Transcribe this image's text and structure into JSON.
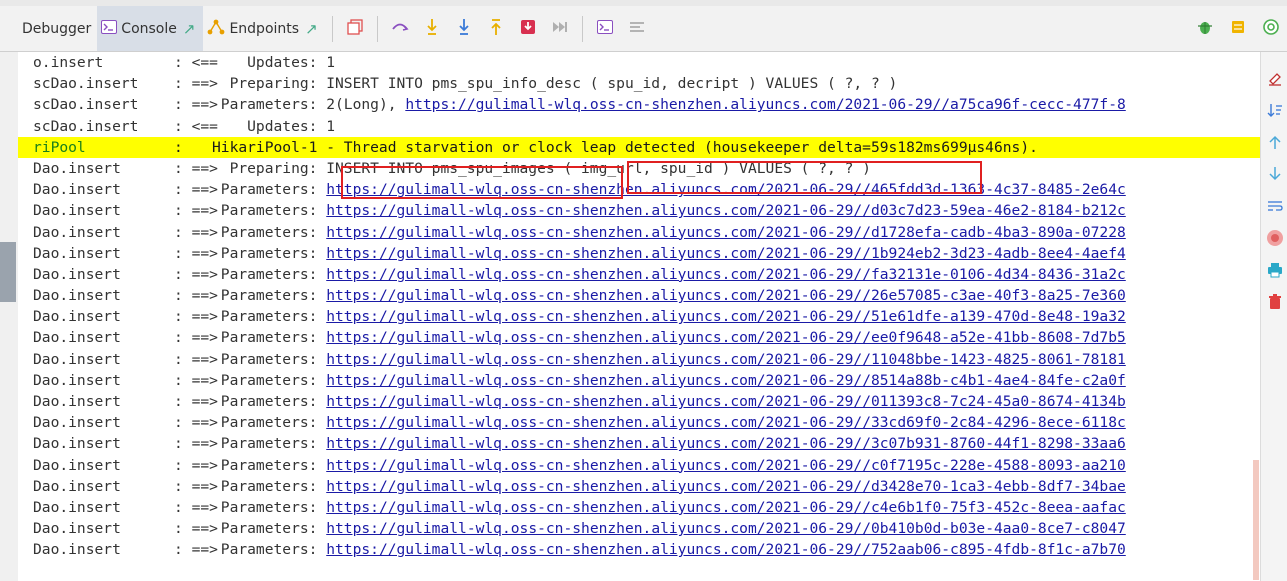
{
  "tabs": {
    "debugger": "Debugger",
    "console": "Console",
    "endpoints": "Endpoints"
  },
  "colors": {
    "accent_green": "#44aa88",
    "highlight_red": "#e02020",
    "warning_bg": "#ffff00",
    "link": "#1a1aa6"
  },
  "console": {
    "lines": [
      {
        "logger": "o.insert",
        "dir": ": <==",
        "label": "    Updates:",
        "text": " 1"
      },
      {
        "logger": "scDao.insert",
        "dir": ": ==>",
        "label": "  Preparing:",
        "text": " INSERT INTO pms_spu_info_desc ( spu_id, decript ) VALUES ( ?, ? )"
      },
      {
        "logger": "scDao.insert",
        "dir": ": ==>",
        "label": " Parameters:",
        "text": " 2(Long), ",
        "url": "https://gulimall-wlq.oss-cn-shenzhen.aliyuncs.com/2021-06-29//a75ca96f-cecc-477f-8"
      },
      {
        "logger": "scDao.insert",
        "dir": ": <==",
        "label": "    Updates:",
        "text": " 1"
      },
      {
        "logger": "riPool",
        "dir": ": ",
        "label": "",
        "text": "HikariPool-1 - Thread starvation or clock leap detected (housekeeper delta=59s182ms699µs46ns).",
        "warn": true
      },
      {
        "logger": "Dao.insert",
        "dir": ": ==>",
        "label": "  Preparing:",
        "text": " INSERT INTO pms_spu_images ( img_url, spu_id ) VALUES ( ?, ? )"
      },
      {
        "logger": "Dao.insert",
        "dir": ": ==>",
        "label": " Parameters:",
        "text": " ",
        "url": "https://gulimall-wlq.oss-cn-shenzhen.aliyuncs.com/2021-06-29//465fdd3d-1363-4c37-8485-2e64c"
      },
      {
        "logger": "Dao.insert",
        "dir": ": ==>",
        "label": " Parameters:",
        "text": " ",
        "url": "https://gulimall-wlq.oss-cn-shenzhen.aliyuncs.com/2021-06-29//d03c7d23-59ea-46e2-8184-b212c"
      },
      {
        "logger": "Dao.insert",
        "dir": ": ==>",
        "label": " Parameters:",
        "text": " ",
        "url": "https://gulimall-wlq.oss-cn-shenzhen.aliyuncs.com/2021-06-29//d1728efa-cadb-4ba3-890a-07228"
      },
      {
        "logger": "Dao.insert",
        "dir": ": ==>",
        "label": " Parameters:",
        "text": " ",
        "url": "https://gulimall-wlq.oss-cn-shenzhen.aliyuncs.com/2021-06-29//1b924eb2-3d23-4adb-8ee4-4aef4"
      },
      {
        "logger": "Dao.insert",
        "dir": ": ==>",
        "label": " Parameters:",
        "text": " ",
        "url": "https://gulimall-wlq.oss-cn-shenzhen.aliyuncs.com/2021-06-29//fa32131e-0106-4d34-8436-31a2c"
      },
      {
        "logger": "Dao.insert",
        "dir": ": ==>",
        "label": " Parameters:",
        "text": " ",
        "url": "https://gulimall-wlq.oss-cn-shenzhen.aliyuncs.com/2021-06-29//26e57085-c3ae-40f3-8a25-7e360"
      },
      {
        "logger": "Dao.insert",
        "dir": ": ==>",
        "label": " Parameters:",
        "text": " ",
        "url": "https://gulimall-wlq.oss-cn-shenzhen.aliyuncs.com/2021-06-29//51e61dfe-a139-470d-8e48-19a32"
      },
      {
        "logger": "Dao.insert",
        "dir": ": ==>",
        "label": " Parameters:",
        "text": " ",
        "url": "https://gulimall-wlq.oss-cn-shenzhen.aliyuncs.com/2021-06-29//ee0f9648-a52e-41bb-8608-7d7b5"
      },
      {
        "logger": "Dao.insert",
        "dir": ": ==>",
        "label": " Parameters:",
        "text": " ",
        "url": "https://gulimall-wlq.oss-cn-shenzhen.aliyuncs.com/2021-06-29//11048bbe-1423-4825-8061-78181"
      },
      {
        "logger": "Dao.insert",
        "dir": ": ==>",
        "label": " Parameters:",
        "text": " ",
        "url": "https://gulimall-wlq.oss-cn-shenzhen.aliyuncs.com/2021-06-29//8514a88b-c4b1-4ae4-84fe-c2a0f"
      },
      {
        "logger": "Dao.insert",
        "dir": ": ==>",
        "label": " Parameters:",
        "text": " ",
        "url": "https://gulimall-wlq.oss-cn-shenzhen.aliyuncs.com/2021-06-29//011393c8-7c24-45a0-8674-4134b"
      },
      {
        "logger": "Dao.insert",
        "dir": ": ==>",
        "label": " Parameters:",
        "text": " ",
        "url": "https://gulimall-wlq.oss-cn-shenzhen.aliyuncs.com/2021-06-29//33cd69f0-2c84-4296-8ece-6118c"
      },
      {
        "logger": "Dao.insert",
        "dir": ": ==>",
        "label": " Parameters:",
        "text": " ",
        "url": "https://gulimall-wlq.oss-cn-shenzhen.aliyuncs.com/2021-06-29//3c07b931-8760-44f1-8298-33aa6"
      },
      {
        "logger": "Dao.insert",
        "dir": ": ==>",
        "label": " Parameters:",
        "text": " ",
        "url": "https://gulimall-wlq.oss-cn-shenzhen.aliyuncs.com/2021-06-29//c0f7195c-228e-4588-8093-aa210"
      },
      {
        "logger": "Dao.insert",
        "dir": ": ==>",
        "label": " Parameters:",
        "text": " ",
        "url": "https://gulimall-wlq.oss-cn-shenzhen.aliyuncs.com/2021-06-29//d3428e70-1ca3-4ebb-8df7-34bae"
      },
      {
        "logger": "Dao.insert",
        "dir": ": ==>",
        "label": " Parameters:",
        "text": " ",
        "url": "https://gulimall-wlq.oss-cn-shenzhen.aliyuncs.com/2021-06-29//c4e6b1f0-75f3-452c-8eea-aafac"
      },
      {
        "logger": "Dao.insert",
        "dir": ": ==>",
        "label": " Parameters:",
        "text": " ",
        "url": "https://gulimall-wlq.oss-cn-shenzhen.aliyuncs.com/2021-06-29//0b410b0d-b03e-4aa0-8ce7-c8047"
      },
      {
        "logger": "Dao.insert",
        "dir": ": ==>",
        "label": " Parameters:",
        "text": " ",
        "url": "https://gulimall-wlq.oss-cn-shenzhen.aliyuncs.com/2021-06-29//752aab06-c895-4fdb-8f1c-a7b70"
      }
    ]
  }
}
